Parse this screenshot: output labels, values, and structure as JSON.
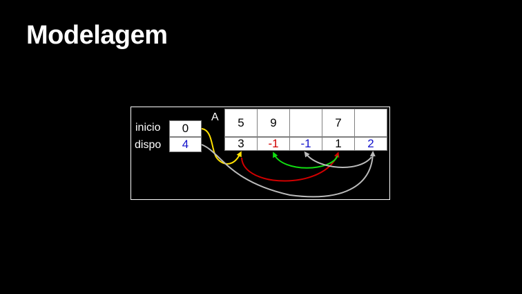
{
  "title": "Modelagem",
  "diagram": {
    "inicio_label": "inicio",
    "disp_label": "dispo",
    "array_label": "A",
    "inicio_value": "0",
    "disp_value": "4",
    "cells": [
      {
        "top": "5",
        "bottom": "3",
        "bottom_color": "#000000"
      },
      {
        "top": "9",
        "bottom": "-1",
        "bottom_color": "#d00000"
      },
      {
        "top": "",
        "bottom": "-1",
        "bottom_color": "#1010cc"
      },
      {
        "top": "7",
        "bottom": "1",
        "bottom_color": "#000000"
      },
      {
        "top": "",
        "bottom": "2",
        "bottom_color": "#1010cc"
      }
    ],
    "colors": {
      "disp_value": "#1010cc",
      "yellow_arrow": "#ffe000",
      "red_arrow": "#d00000",
      "green_arrow": "#11dd11",
      "gray_arrow": "#bbbbbb"
    }
  }
}
